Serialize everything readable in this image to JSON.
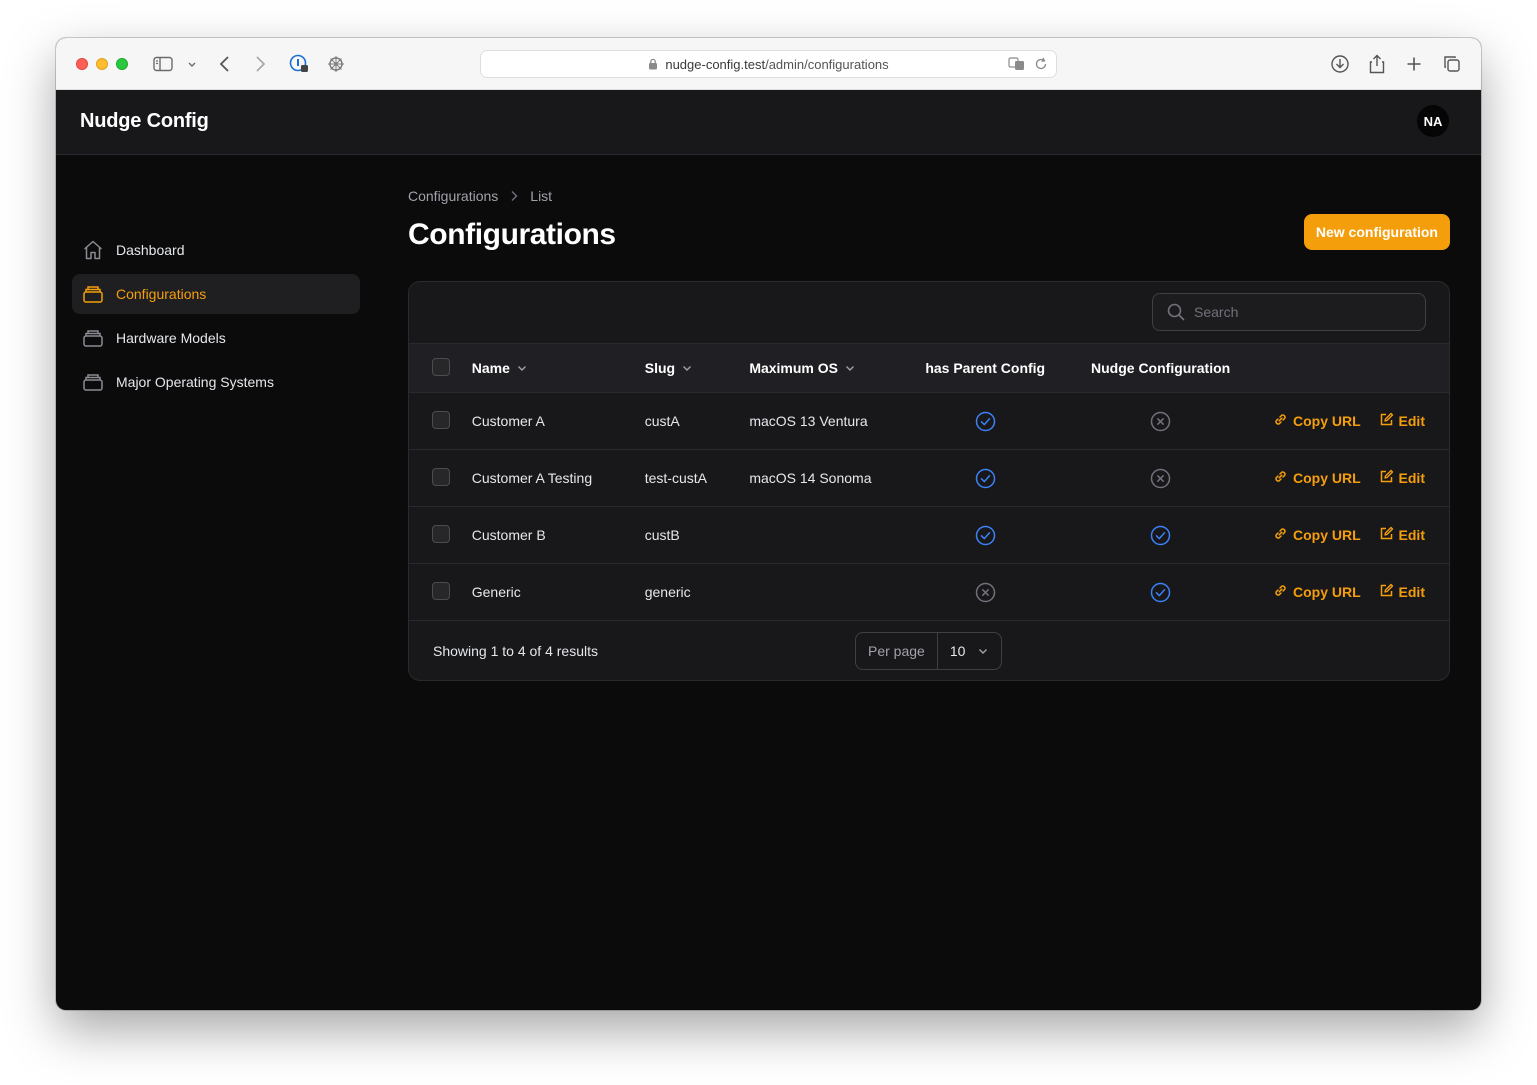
{
  "browser": {
    "url_host": "nudge-config.test",
    "url_path": "/admin/configurations"
  },
  "app": {
    "title": "Nudge Config",
    "user_initials": "NA"
  },
  "sidebar": {
    "items": [
      {
        "label": "Dashboard",
        "icon": "home-icon",
        "active": false
      },
      {
        "label": "Configurations",
        "icon": "stack-icon",
        "active": true
      },
      {
        "label": "Hardware Models",
        "icon": "stack-icon",
        "active": false
      },
      {
        "label": "Major Operating Systems",
        "icon": "stack-icon",
        "active": false
      }
    ]
  },
  "breadcrumb": [
    "Configurations",
    "List"
  ],
  "page": {
    "title": "Configurations",
    "new_button": "New configuration"
  },
  "search": {
    "placeholder": "Search"
  },
  "table": {
    "columns": [
      {
        "label": "Name",
        "sortable": true
      },
      {
        "label": "Slug",
        "sortable": true
      },
      {
        "label": "Maximum OS",
        "sortable": true
      },
      {
        "label": "has Parent Config",
        "sortable": false
      },
      {
        "label": "Nudge Configuration",
        "sortable": false
      }
    ],
    "rows": [
      {
        "name": "Customer A",
        "slug": "custA",
        "max_os": "macOS 13 Ventura",
        "has_parent": true,
        "nudge_config": false
      },
      {
        "name": "Customer A Testing",
        "slug": "test-custA",
        "max_os": "macOS 14 Sonoma",
        "has_parent": true,
        "nudge_config": false
      },
      {
        "name": "Customer B",
        "slug": "custB",
        "max_os": "",
        "has_parent": true,
        "nudge_config": true
      },
      {
        "name": "Generic",
        "slug": "generic",
        "max_os": "",
        "has_parent": false,
        "nudge_config": true
      }
    ],
    "row_actions": {
      "copy": "Copy URL",
      "edit": "Edit"
    }
  },
  "footer": {
    "showing": "Showing 1 to 4 of 4 results",
    "per_page_label": "Per page",
    "per_page_value": "10"
  },
  "colors": {
    "accent": "#f59e0b",
    "check_blue": "#3b82f6",
    "x_gray": "#71717a",
    "background": "#0b0b0c",
    "surface": "#18181b"
  }
}
